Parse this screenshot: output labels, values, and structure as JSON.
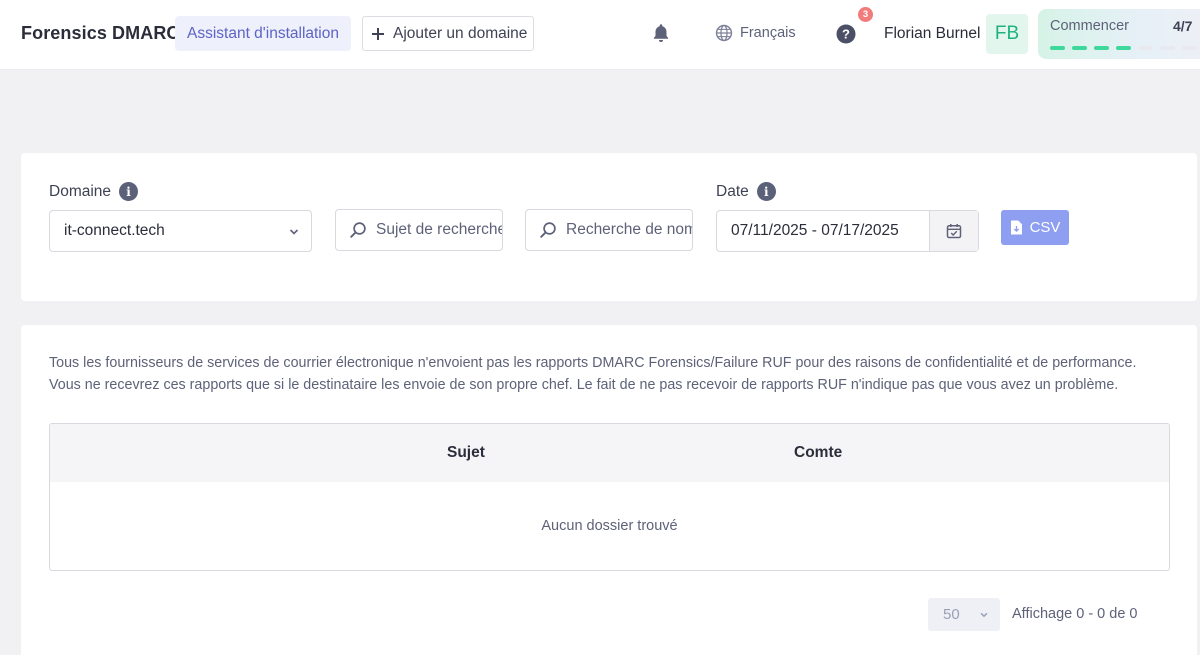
{
  "header": {
    "app_title": "Forensics DMARC",
    "wizard_label": "Assistant d'installation",
    "add_domain_label": "Ajouter un domaine",
    "language": "Français",
    "help_badge_count": "3",
    "user_name": "Florian Burnel",
    "avatar_initials": "FB",
    "onboarding": {
      "label": "Commencer",
      "progress": "4/7",
      "completed_steps": 4,
      "total_steps": 7
    }
  },
  "filters": {
    "domain_label": "Domaine",
    "domain_value": "it-connect.tech",
    "subject_search_placeholder": "Sujet de recherche",
    "name_search_placeholder": "Recherche de nom",
    "date_label": "Date",
    "date_range": "07/11/2025 - 07/17/2025",
    "csv_label": "CSV"
  },
  "results": {
    "notice_line1": "Tous les fournisseurs de services de courrier électronique n'envoient pas les rapports DMARC Forensics/Failure RUF pour des raisons de confidentialité et de performance.",
    "notice_line2": "Vous ne recevrez ces rapports que si le destinataire les envoie de son propre chef. Le fait de ne pas recevoir de rapports RUF n'indique pas que vous avez un problème.",
    "columns": [
      "Sujet",
      "Comte"
    ],
    "empty_message": "Aucun dossier trouvé",
    "per_page": "50",
    "paging_info": "Affichage 0 - 0 de 0"
  },
  "colors": {
    "accent": "#5d63c6",
    "csv_button": "#8e9ef0",
    "progress_done": "#3ed89c",
    "badge": "#f27b7b",
    "avatar_text": "#1fb37c"
  },
  "icons": [
    "plus-icon",
    "bell-icon",
    "globe-icon",
    "help-icon",
    "info-icon",
    "chevron-down-icon",
    "search-icon",
    "calendar-icon",
    "file-download-icon"
  ]
}
